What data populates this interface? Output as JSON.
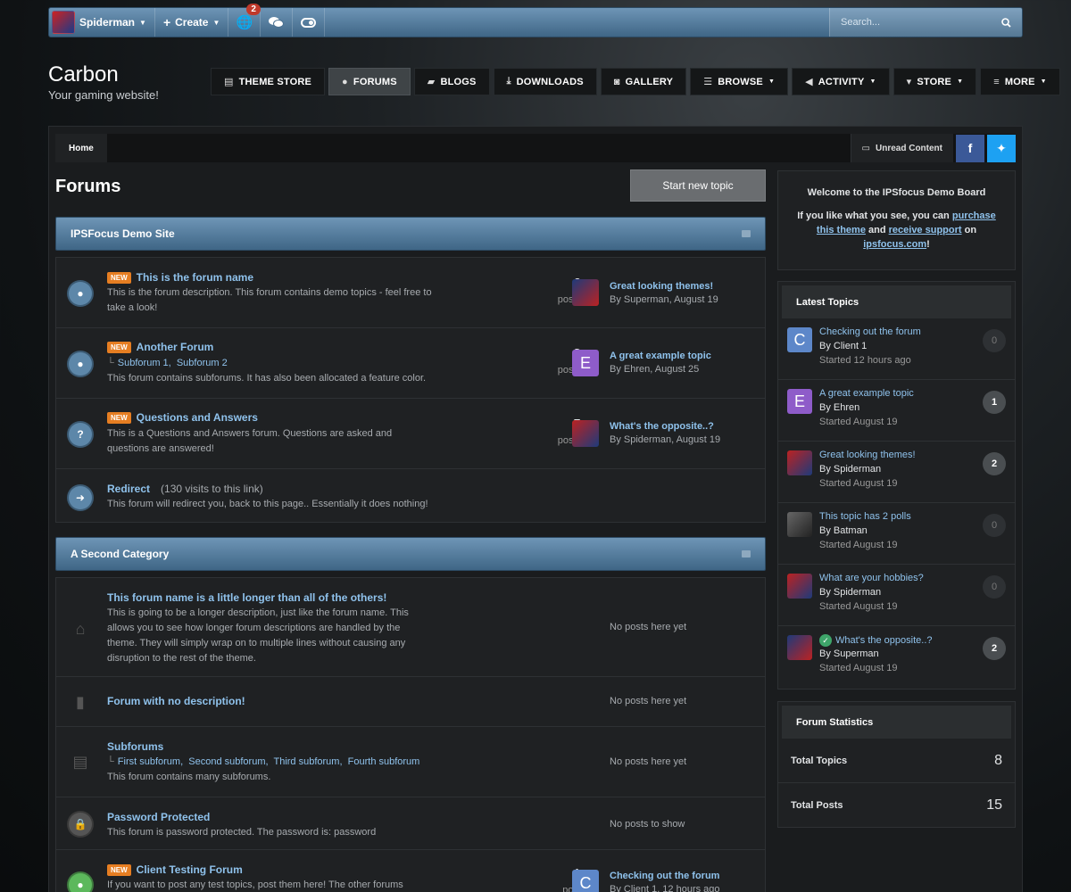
{
  "topbar": {
    "user": "Spiderman",
    "create": "Create",
    "notif_count": "2",
    "search_placeholder": "Search..."
  },
  "brand": {
    "title": "Carbon",
    "subtitle": "Your gaming website!"
  },
  "nav": [
    {
      "label": "THEME STORE",
      "icon": "document-icon"
    },
    {
      "label": "FORUMS",
      "icon": "chat-icon"
    },
    {
      "label": "BLOGS",
      "icon": "book-icon"
    },
    {
      "label": "DOWNLOADS",
      "icon": "download-icon"
    },
    {
      "label": "GALLERY",
      "icon": "camera-icon"
    },
    {
      "label": "BROWSE",
      "icon": "list-icon"
    },
    {
      "label": "ACTIVITY",
      "icon": "megaphone-icon"
    },
    {
      "label": "STORE",
      "icon": "cart-icon"
    },
    {
      "label": "MORE",
      "icon": "menu-icon"
    }
  ],
  "breadcrumb": {
    "home": "Home",
    "unread": "Unread Content"
  },
  "page": {
    "title": "Forums",
    "new_topic": "Start new topic"
  },
  "categories": [
    {
      "title": "IPSFocus Demo Site"
    },
    {
      "title": "A Second Category"
    }
  ],
  "forums1": [
    {
      "title": "This is the forum name",
      "desc": "This is the forum description. This forum contains demo topics - feel free to take a look!",
      "count": "6",
      "unit": "posts",
      "last_title": "Great looking themes!",
      "last_by": "By Superman, August 19"
    },
    {
      "title": "Another Forum",
      "sub1": "Subforum 1,",
      "sub2": "Subforum 2",
      "desc": "This forum contains subforums. It has also been allocated a feature color.",
      "count": "3",
      "unit": "posts",
      "last_title": "A great example topic",
      "last_by": "By Ehren, August 25"
    },
    {
      "title": "Questions and Answers",
      "desc": "This is a Questions and Answers forum. Questions are asked and questions are answered!",
      "count": "5",
      "unit": "posts",
      "last_title": "What's the opposite..?",
      "last_by": "By Spiderman, August 19"
    },
    {
      "title": "Redirect",
      "visits": "(130 visits to this link)",
      "desc": "This forum will redirect you, back to this page.. Essentially it does nothing!"
    }
  ],
  "forums2": [
    {
      "title": "This forum name is a little longer than all of the others!",
      "desc": "This is going to be a longer description, just like the forum name. This allows you to see how longer forum descriptions are handled by the theme. They will simply wrap on to multiple lines without causing any disruption to the rest of the theme.",
      "empty": "No posts here yet"
    },
    {
      "title": "Forum with no description!",
      "empty": "No posts here yet"
    },
    {
      "title": "Subforums",
      "subs": [
        "First subforum,",
        "Second subforum,",
        "Third subforum,",
        "Fourth subforum"
      ],
      "desc": "This forum contains many subforums.",
      "empty": "No posts here yet"
    },
    {
      "title": "Password Protected",
      "desc": "This forum is password protected. The password is: password",
      "empty": "No posts to show"
    },
    {
      "title": "Client Testing Forum",
      "desc": "If you want to post any test topics, post them here! The other forums",
      "count": "1",
      "unit": "post",
      "last_title": "Checking out the forum",
      "last_by": "By Client 1, 12 hours ago"
    }
  ],
  "welcome": {
    "title": "Welcome to the IPSfocus Demo Board",
    "l1": "If you like what you see, you can",
    "purchase": "purchase this theme",
    "and": "and",
    "support": "receive support",
    "on": "on",
    "site": "ipsfocus.com",
    "bang": "!"
  },
  "latest": {
    "title": "Latest Topics",
    "items": [
      {
        "title": "Checking out the forum",
        "by": "By Client 1",
        "started": "Started 12 hours ago",
        "count": "0",
        "letter": "C"
      },
      {
        "title": "A great example topic",
        "by": "By Ehren",
        "started": "Started August 19",
        "count": "1",
        "letter": "E"
      },
      {
        "title": "Great looking themes!",
        "by": "By Spiderman",
        "started": "Started August 19",
        "count": "2"
      },
      {
        "title": "This topic has 2 polls",
        "by": "By Batman",
        "started": "Started August 19",
        "count": "0"
      },
      {
        "title": "What are your hobbies?",
        "by": "By Spiderman",
        "started": "Started August 19",
        "count": "0"
      },
      {
        "title": "What's the opposite..?",
        "by": "By Superman",
        "started": "Started August 19",
        "count": "2"
      }
    ]
  },
  "stats": {
    "title": "Forum Statistics",
    "topics_label": "Total Topics",
    "topics": "8",
    "posts_label": "Total Posts",
    "posts": "15"
  },
  "colors": {
    "accent": "#5d87a9",
    "new_badge": "#e67e22",
    "link": "#8fc2ec"
  }
}
